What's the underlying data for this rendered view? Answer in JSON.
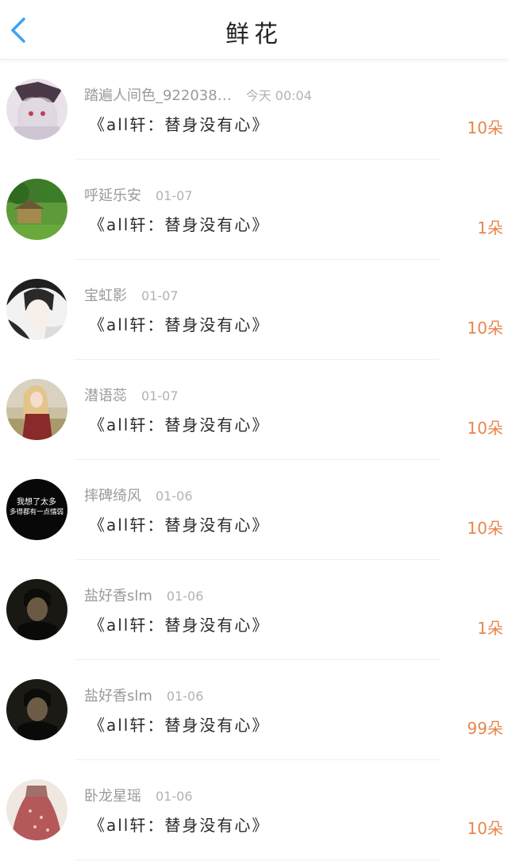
{
  "header": {
    "title": "鲜花",
    "back_icon": "chevron-left-icon",
    "accent": "#3da2f2"
  },
  "rows": [
    {
      "user": "踏遍人间色_922038…",
      "date": "今天 00:04",
      "story": "《all轩：替身没有心》",
      "count": "10朵"
    },
    {
      "user": "呼延乐安",
      "date": "01-07",
      "story": "《all轩：替身没有心》",
      "count": "1朵"
    },
    {
      "user": "宝虹影",
      "date": "01-07",
      "story": "《all轩：替身没有心》",
      "count": "10朵"
    },
    {
      "user": "潜语蕊",
      "date": "01-07",
      "story": "《all轩：替身没有心》",
      "count": "10朵"
    },
    {
      "user": "摔碑绮风",
      "date": "01-06",
      "story": "《all轩：替身没有心》",
      "count": "10朵",
      "avatar_text": [
        "我想了太多",
        "多得都有一点懦弱"
      ]
    },
    {
      "user": "盐好香slm",
      "date": "01-06",
      "story": "《all轩：替身没有心》",
      "count": "1朵"
    },
    {
      "user": "盐好香slm",
      "date": "01-06",
      "story": "《all轩：替身没有心》",
      "count": "99朵"
    },
    {
      "user": "卧龙星瑶",
      "date": "01-06",
      "story": "《all轩：替身没有心》",
      "count": "10朵"
    }
  ]
}
